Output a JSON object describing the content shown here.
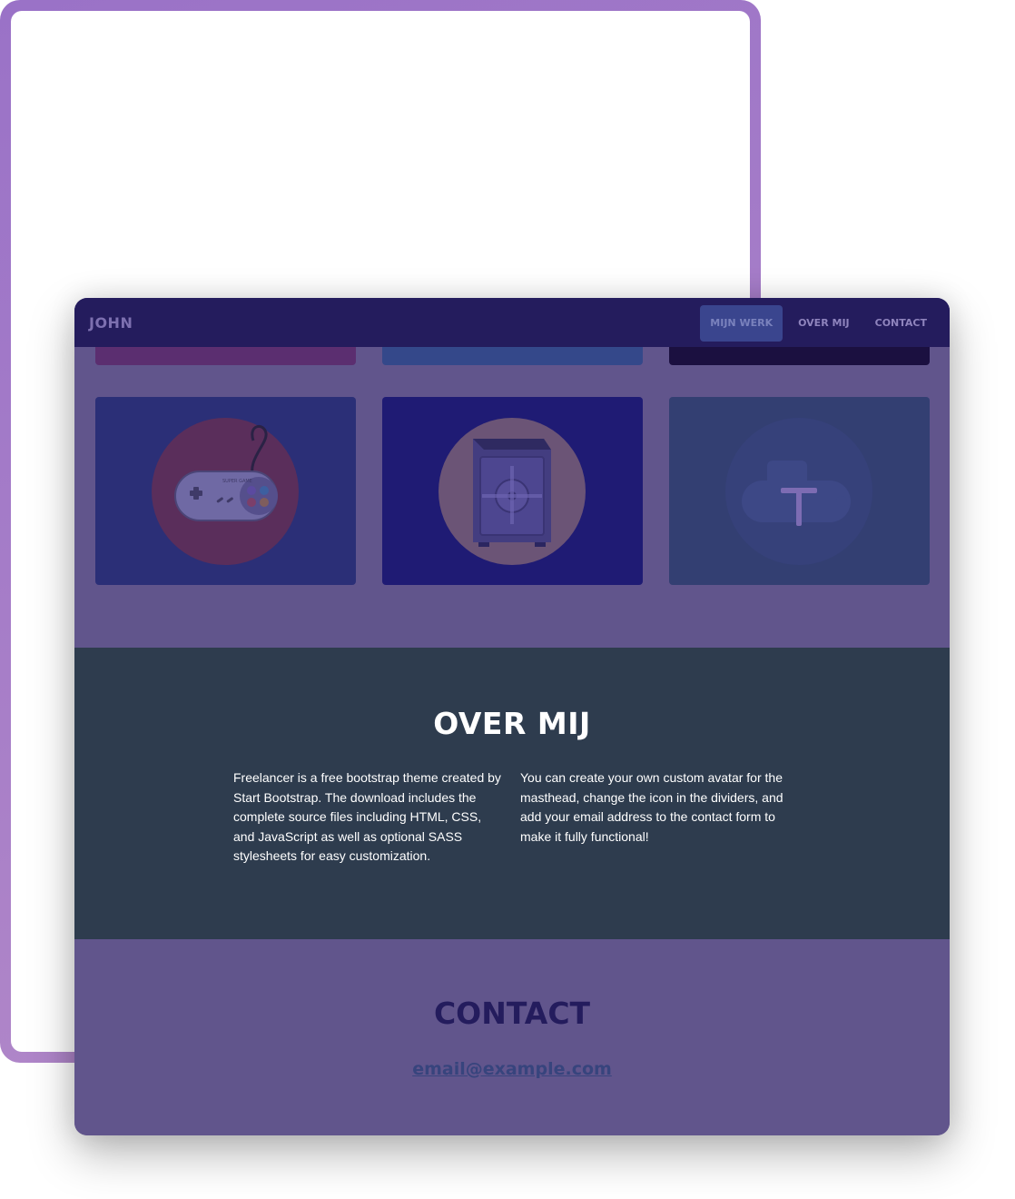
{
  "navbar": {
    "brand": "JOHN",
    "links": [
      {
        "label": "MIJN WERK",
        "active": true
      },
      {
        "label": "OVER MIJ",
        "active": false
      },
      {
        "label": "CONTACT",
        "active": false
      }
    ]
  },
  "portfolio": {
    "top_strip_colors": [
      "#5b2e70",
      "#34488a",
      "#1b1040"
    ],
    "tiles": [
      {
        "icon": "game-controller-icon",
        "bg": "#2b2f77",
        "circle": "#5a2e5b"
      },
      {
        "icon": "safe-icon",
        "bg": "#1f1b74",
        "circle": "#6b5476"
      },
      {
        "icon": "submarine-icon",
        "bg": "#333f72",
        "circle": "#36417a",
        "hover_overlay_icon": "plus-icon"
      }
    ],
    "controller_text": "SUPER GAME"
  },
  "about": {
    "title": "OVER MIJ",
    "col1": "Freelancer is a free bootstrap theme created by Start Bootstrap. The download includes the complete source files including HTML, CSS, and JavaScript as well as optional SASS stylesheets for easy customization.",
    "col2": "You can create your own custom avatar for the masthead, change the icon in the dividers, and add your email address to the contact form to make it fully functional!"
  },
  "contact": {
    "title": "CONTACT",
    "email": "email@example.com"
  },
  "colors": {
    "navbar_bg": "#241c5d",
    "section_bg": "#61558c",
    "about_bg": "#2e3c4e",
    "frame_accent": "#9a72c7"
  }
}
